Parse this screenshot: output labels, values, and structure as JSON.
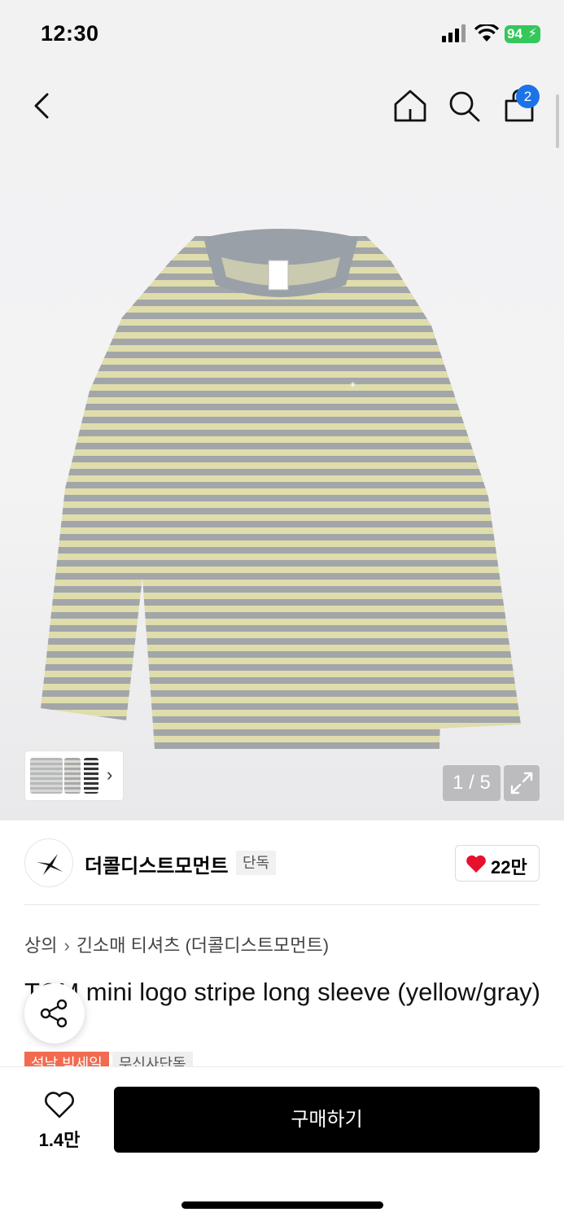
{
  "status_bar": {
    "time": "12:30",
    "battery": "94"
  },
  "nav": {
    "cart_count": "2"
  },
  "gallery": {
    "counter": "1 / 5"
  },
  "brand": {
    "name": "더콜디스트모먼트",
    "tag": "단독",
    "likes": "22만"
  },
  "breadcrumb": {
    "category": "상의",
    "subcategory": "긴소매 티셔츠 (더콜디스트모먼트)"
  },
  "product": {
    "title": "TCM mini logo stripe long sleeve (yellow/gray)",
    "tags": [
      "설날 빅세일",
      "무신사단독"
    ]
  },
  "bottom": {
    "wish_count": "1.4만",
    "buy_label": "구매하기"
  },
  "colors": {
    "accent_blue": "#1a73e8",
    "heart_red": "#e8102c",
    "sale_orange": "#f26a4f",
    "battery_green": "#34c759"
  },
  "icons": [
    "back-icon",
    "home-icon",
    "search-icon",
    "shopping-bag-icon",
    "expand-icon",
    "heart-icon",
    "share-icon"
  ]
}
